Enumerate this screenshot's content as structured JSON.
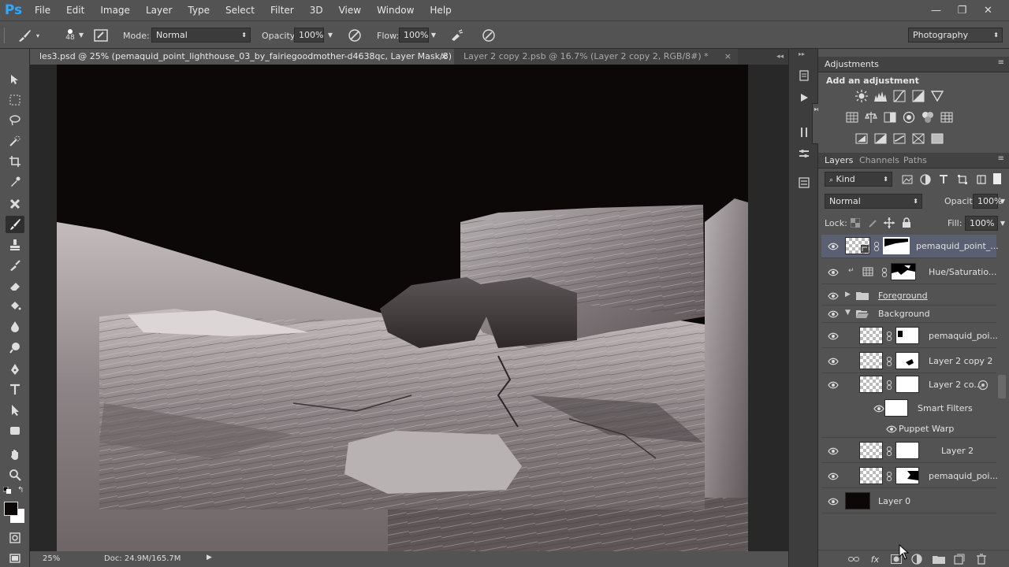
{
  "app": {
    "logo": "Ps",
    "workspace": "Photography"
  },
  "menu": [
    "File",
    "Edit",
    "Image",
    "Layer",
    "Type",
    "Select",
    "Filter",
    "3D",
    "View",
    "Window",
    "Help"
  ],
  "window_controls": [
    "—",
    "❐",
    "✕"
  ],
  "options": {
    "brush_size": "48",
    "mode_label": "Mode:",
    "mode_value": "Normal",
    "opacity_label": "Opacity:",
    "opacity_value": "100%",
    "flow_label": "Flow:",
    "flow_value": "100%"
  },
  "tabs": [
    {
      "label": "les3.psd @ 25% (pemaquid_point_lighthouse_03_by_fairiegoodmother-d4638qc, Layer Mask/8) *",
      "close": "×"
    },
    {
      "label": "Layer 2 copy 2.psb @ 16.7% (Layer 2 copy 2, RGB/8#) *",
      "close": "×"
    }
  ],
  "status": {
    "zoom": "25%",
    "doc": "Doc: 24.9M/165.7M"
  },
  "adjustments": {
    "tab": "Adjustments",
    "title": "Add an adjustment"
  },
  "layers_panel": {
    "tabs": [
      "Layers",
      "Channels",
      "Paths"
    ],
    "filter_kind": "Kind",
    "blend_mode": "Normal",
    "opacity_label": "Opacity:",
    "opacity_value": "100%",
    "lock_label": "Lock:",
    "fill_label": "Fill:",
    "fill_value": "100%",
    "layers": [
      {
        "name": "pemaquid_point_..."
      },
      {
        "name": "Hue/Saturatio..."
      },
      {
        "name": "Foreground"
      },
      {
        "name": "Background"
      },
      {
        "name": "pemaquid_poi..."
      },
      {
        "name": "Layer 2 copy 2"
      },
      {
        "name": "Layer 2 co..."
      },
      {
        "name": "Smart Filters"
      },
      {
        "name": "Puppet Warp"
      },
      {
        "name": "Layer 2"
      },
      {
        "name": "pemaquid_poi..."
      },
      {
        "name": "Layer 0"
      }
    ]
  },
  "colors": {
    "accent": "#31a8ff",
    "panel": "#535353",
    "dark": "#282828",
    "selected_layer": "#5a5f72"
  }
}
